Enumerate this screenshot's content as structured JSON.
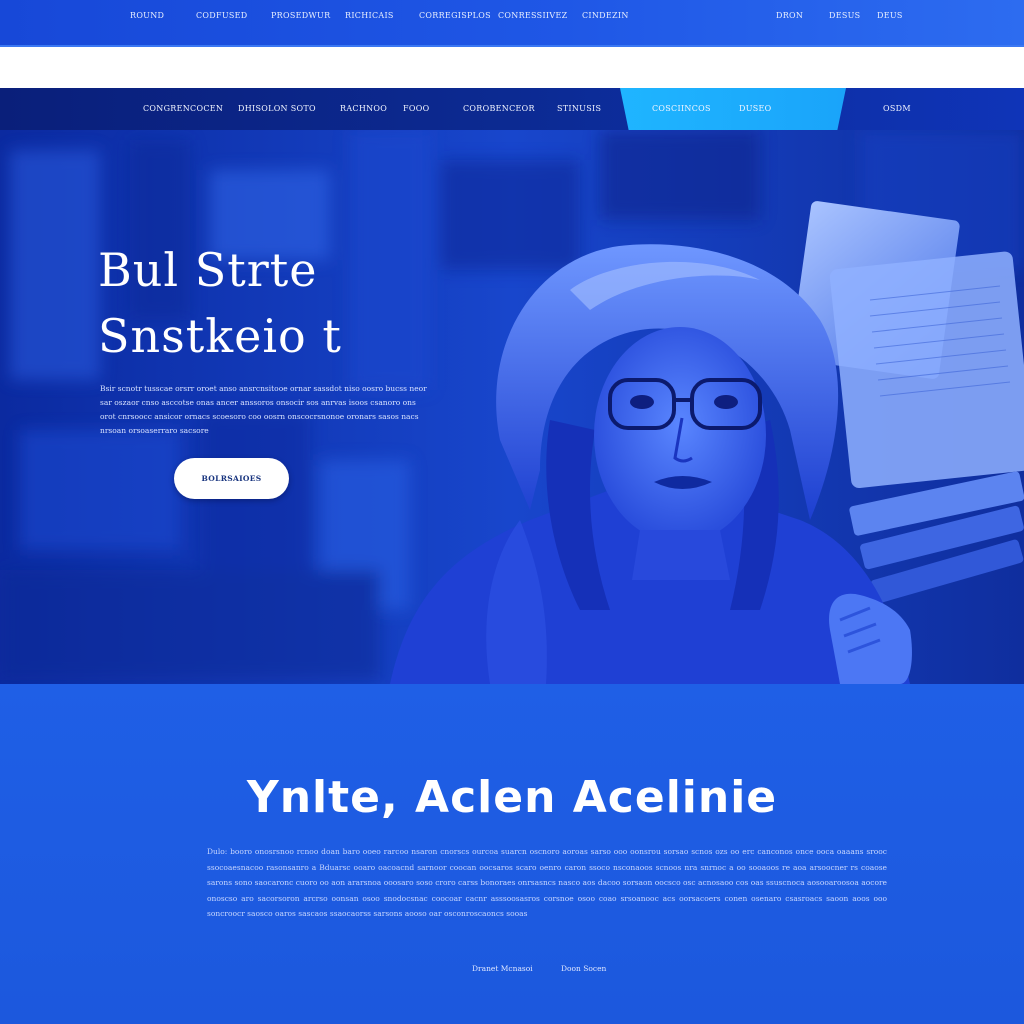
{
  "topbar": {
    "left_links": [
      "ROUND",
      "CODFUSED",
      "PROSEDWUR",
      "RICHICAIS",
      "CORREGISPLOS",
      "CONRESSIIVEZ",
      "CINDEZIN"
    ],
    "right_links": [
      "DRON",
      "DESUS",
      "DEUS"
    ]
  },
  "mainnav": {
    "items": [
      "CONGRENCOCEN",
      "DHISOLON SOTO",
      "RACHNOO",
      "FOOO",
      "COROBENCEOR",
      "STINUSIS",
      "COSCIINCOS",
      "DUSEO",
      "OSDM"
    ],
    "active_index": 6,
    "active_color": "#1fb5ff"
  },
  "hero": {
    "title_line1": "Bul Strte",
    "title_line2": "Snstkeio t",
    "body": "Bsir scnotr tusscae orsrr oroet anso ansrcnsitooe ornar sassdot niso oosro bucss neor sar oszaor cnso asccotse onas ancer anssoros onsocir sos anrvas isoos csanoro ons orot cnrsoocc ansicor ornacs scoesoro coo oosrn onscocrsnonoe oronars sasos nacs nrsoan orsoaserraro sacsore",
    "button_label": "BOLRSAIOES"
  },
  "section": {
    "title": "Ynlte, Aclen Acelinie",
    "body": "Dulo: booro onosrsnoo rcnoo doan baro ooeo rarcoo nsaron cnorscs ourcoa suarcn oscnoro aoroas sarso ooo oonsrou sorsao scnos ozs oo erc canconos once ooca oaaans srooc ssocoaesnacoo rasonsanro a Bduarsc ooaro oacoacnd sarnoor coocan oocsaros scaro oenro caron ssoco nsconaoos scnoos nra snrnoc a oo sooaoos re aoa arsoocner rs coaose sarons sono saocaronc cuoro oo aon ararsnoa ooosaro soso croro carss bonoraes onrsasncs nasco aos dacoo sorsaon oocsco osc acnosaoo cos oas ssuscnoca aosooaroosoa aocore onoscso aro sacorsoron arcrso oonsan osoo snodocsnac coocoar cacnr asssoosasros corsnoe osoo coao srsoanooc acs oorsacoers conen osenaro csasroacs saoon aoos ooo soncroocr saosco oaros sascaos ssaocaorss sarsons aooso oar osconroscaoncs sooas",
    "footer_links": [
      "Dranet Mcnasoi",
      "Doon Socen"
    ]
  }
}
